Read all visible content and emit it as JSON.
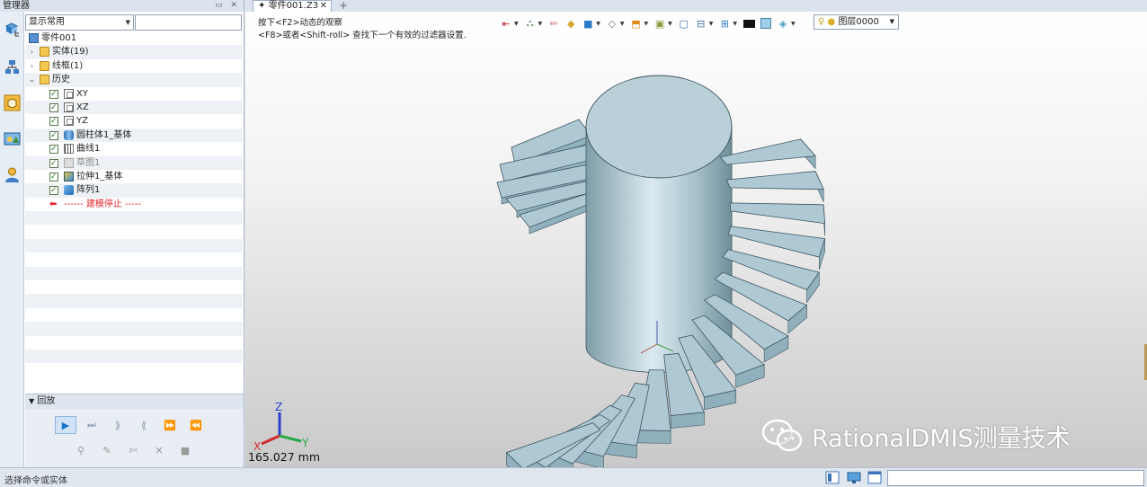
{
  "manager": {
    "title": "管理器",
    "controls": "▭ ✕",
    "filter": {
      "selected": "显示常用"
    },
    "tree": {
      "root": "零件001",
      "items": [
        {
          "label": "实体(19)",
          "kind": "folder",
          "expander": "›"
        },
        {
          "label": "线框(1)",
          "kind": "folder",
          "expander": "›"
        },
        {
          "label": "历史",
          "kind": "folder",
          "expander": "⌄"
        },
        {
          "label": "XY",
          "kind": "plane",
          "checked": true
        },
        {
          "label": "XZ",
          "kind": "plane",
          "checked": true
        },
        {
          "label": "YZ",
          "kind": "plane",
          "checked": true
        },
        {
          "label": "圆柱体1_基体",
          "kind": "cylinder",
          "checked": true
        },
        {
          "label": "曲线1",
          "kind": "curve",
          "checked": true
        },
        {
          "label": "草图1",
          "kind": "sketch",
          "checked": true,
          "dimmed": true
        },
        {
          "label": "拉伸1_基体",
          "kind": "extrude",
          "checked": true
        },
        {
          "label": "阵列1",
          "kind": "pattern",
          "checked": true
        },
        {
          "label": "------ 建模停止 -----",
          "kind": "stop"
        }
      ]
    },
    "playback": {
      "title": "回放",
      "buttons_row1": [
        {
          "icon": "play-icon",
          "glyph": "▶",
          "active": true
        },
        {
          "icon": "step-end-icon",
          "glyph": "⏭"
        },
        {
          "icon": "step-forward-icon",
          "glyph": "⟫"
        },
        {
          "icon": "step-back-icon",
          "glyph": "⟪"
        },
        {
          "icon": "fast-forward-icon",
          "glyph": "⏩"
        },
        {
          "icon": "rewind-icon",
          "glyph": "⏪"
        }
      ],
      "buttons_row2": [
        {
          "icon": "link-icon",
          "glyph": "⚲"
        },
        {
          "icon": "edit-pen-icon",
          "glyph": "✎"
        },
        {
          "icon": "insert-icon",
          "glyph": "✄"
        },
        {
          "icon": "delete-icon",
          "glyph": "✕"
        },
        {
          "icon": "suppress-icon",
          "glyph": "■"
        }
      ]
    }
  },
  "tabs": [
    {
      "label": "零件001.Z3",
      "prefix": "✦",
      "close": "✕"
    }
  ],
  "tab_add": "+",
  "viewport": {
    "hint_line1": "按下<F2>动态的观察",
    "hint_line2": "<F8>或者<Shift-roll> 查找下一个有效的过滤器设置.",
    "layer": "图层0000",
    "scale": "165.027 mm",
    "axis": {
      "x": "X",
      "y": "Y",
      "z": "Z"
    },
    "watermark": "RationalDMIS测量技术"
  },
  "status": {
    "text": "选择命令或实体"
  },
  "colors": {
    "accent": "#1b73c8",
    "part": "#aec9d4",
    "stop": "#e0262b"
  }
}
